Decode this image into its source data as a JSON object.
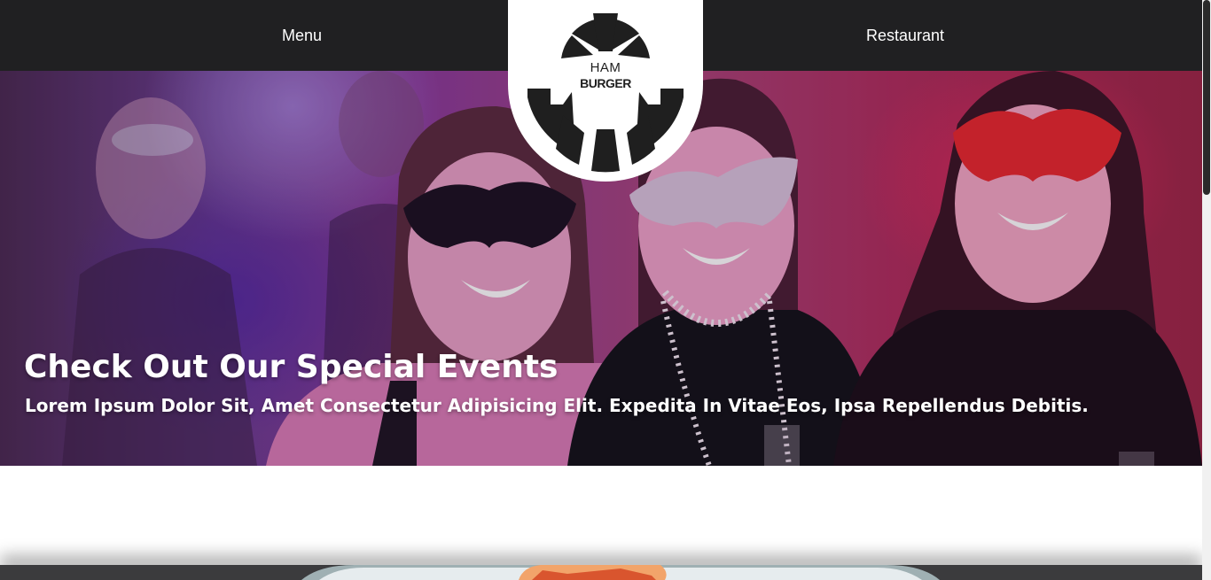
{
  "nav": {
    "left_link": "Menu",
    "right_link": "Restaurant"
  },
  "logo": {
    "line1": "HAM",
    "line2": "BURGER",
    "icon": "hamburger-logo-icon"
  },
  "hero": {
    "title": "Check Out Our Special Events",
    "subtitle": "Lorem Ipsum Dolor Sit, Amet Consectetur Adipisicing Elit. Expedita In Vitae Eos, Ipsa Repellendus Debitis.",
    "image": "masquerade-party-photo"
  },
  "colors": {
    "nav_background": "#202022",
    "logo_ink": "#1f1f1f",
    "text_light": "#ffffff"
  }
}
